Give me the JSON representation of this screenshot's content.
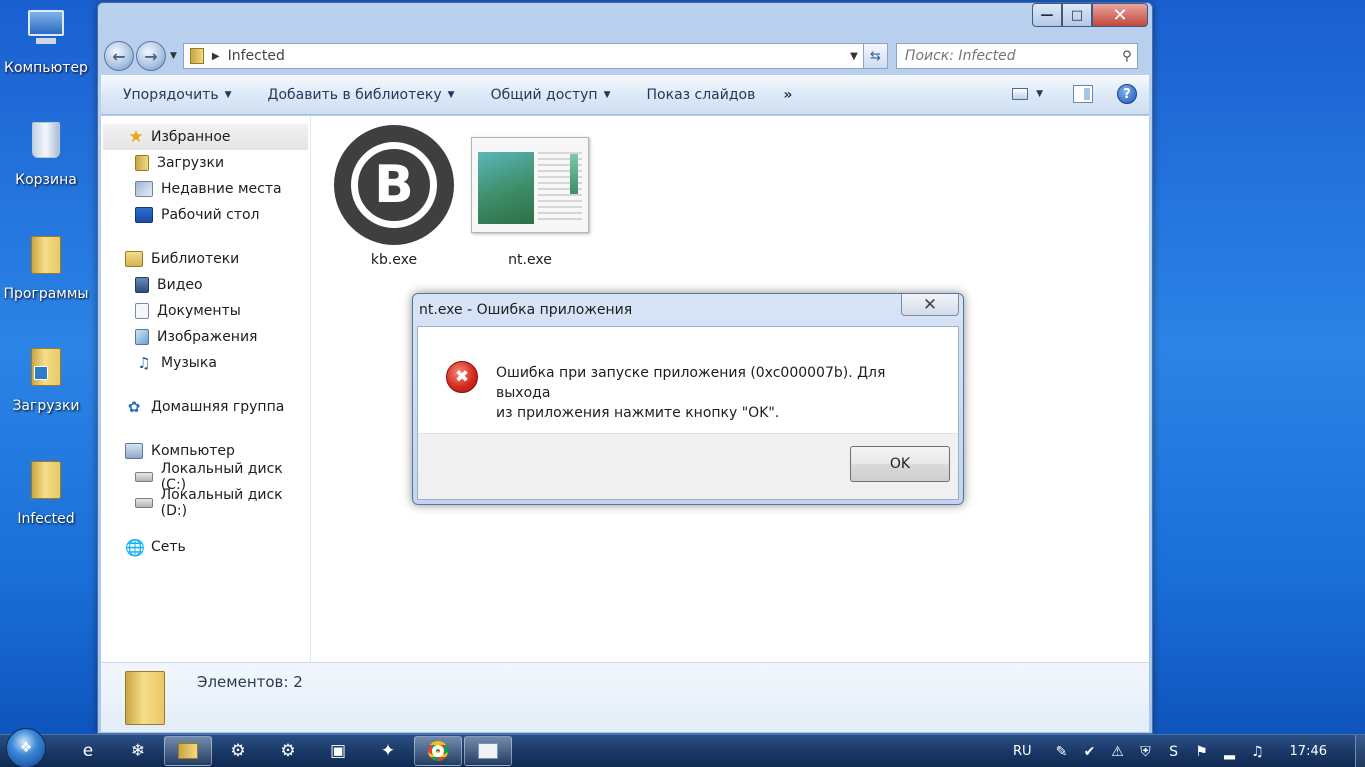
{
  "desktop": {
    "icons": [
      {
        "label": "Компьютер"
      },
      {
        "label": "Корзина"
      },
      {
        "label": "Программы"
      },
      {
        "label": "Загрузки"
      },
      {
        "label": "Infected"
      }
    ]
  },
  "window": {
    "address": "Infected",
    "search_placeholder": "Поиск: Infected",
    "toolbar": {
      "organize": "Упорядочить",
      "add_library": "Добавить в библиотеку",
      "share": "Общий доступ",
      "slideshow": "Показ слайдов",
      "more": "»"
    },
    "nav": {
      "favorites": "Избранное",
      "downloads": "Загрузки",
      "recent": "Недавние места",
      "desktop": "Рабочий стол",
      "libraries": "Библиотеки",
      "video": "Видео",
      "documents": "Документы",
      "images": "Изображения",
      "music": "Музыка",
      "homegroup": "Домашняя группа",
      "computer": "Компьютер",
      "disk_c": "Локальный диск (C:)",
      "disk_d": "Локальный диск (D:)",
      "network": "Сеть"
    },
    "files": [
      {
        "name": "kb.exe",
        "logo_letter": "B"
      },
      {
        "name": "nt.exe"
      }
    ],
    "details": {
      "count": "Элементов: 2"
    }
  },
  "dialog": {
    "title": "nt.exe - Ошибка приложения",
    "message_line1": "Ошибка при запуске приложения (0xc000007b). Для выхода",
    "message_line2": "из приложения нажмите кнопку \"OK\".",
    "ok": "OK"
  },
  "taskbar": {
    "lang": "RU",
    "time": "17:46"
  },
  "colors": {
    "desktop_blue": "#2b84e6",
    "error_red": "#d52b1e",
    "taskbar": "#1b3a68"
  }
}
